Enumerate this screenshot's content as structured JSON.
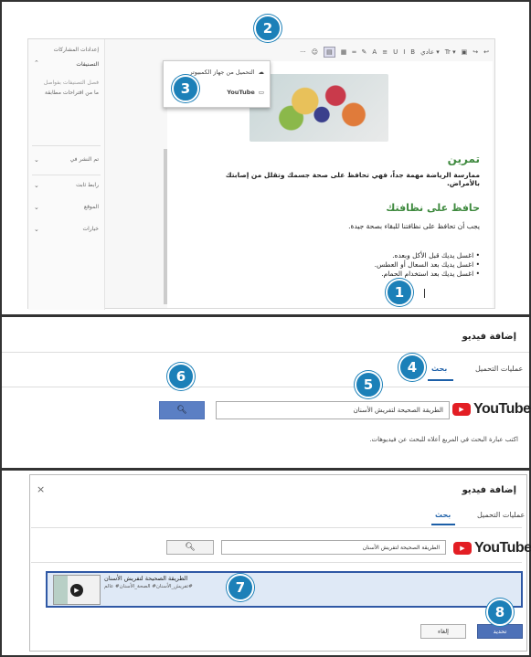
{
  "editor": {
    "toolbar_items": [
      "↩",
      "↪",
      "▣",
      "Tr ▾",
      "عادي ▾",
      "B",
      "I",
      "U",
      "≡",
      "A",
      "✎",
      "═",
      "▦",
      "▤",
      "☺",
      "···"
    ],
    "side_panel": {
      "header": "إعدادات المشاركات",
      "section_label": "التصنيفات",
      "search_hint": "فصل التصنيفات بفواصل",
      "suggestion": "ما من اقتراحات مطابقة",
      "items": [
        "تم النشر في",
        "رابط ثابت",
        "الموقع",
        "خيارات"
      ]
    },
    "dropdown": {
      "upload_label": "التحميل من جهاز الكمبيوتر",
      "youtube_label": "YouTube"
    },
    "doc": {
      "heading": "تمرين",
      "paragraph": "ممارسة الرياضة مهمة جداً، فهي تحافظ على صحة جسمك وتقلل من إصابتك بالأمراض.",
      "subheading": "حافظ على نظافتك",
      "intro": "يجب أن تحافظ على نظافتنا للبقاء بصحة جيدة.",
      "bullets": [
        "اغسل يديك قبل الأكل وبعده.",
        "اغسل يديك بعد السعال أو العطس.",
        "اغسل يديك بعد استخدام الحمام."
      ]
    }
  },
  "add_video": {
    "title": "إضافة فيديو",
    "tab_search": "بحث",
    "tab_uploads": "عمليات التحميل",
    "youtube_word": "YouTube",
    "search_value": "الطريقة الصحيحة لتفريش الأسنان",
    "hint": "اكتب عبارة البحث في المربع أعلاه للبحث عن فيديوهات."
  },
  "results_dialog": {
    "title": "إضافة فيديو",
    "tab_search": "بحث",
    "tab_uploads": "عمليات التحميل",
    "youtube_word": "YouTube",
    "search_value": "الطريقة الصحيحة لتفريش الأسنان",
    "result_title": "الطريقة الصحيحة لتفريش الأسنان",
    "result_tags": "تفريش_الأسنان# الصحة_الأسنان# عالم#",
    "select_label": "تحديد",
    "cancel_label": "إلغاء",
    "close": "×"
  },
  "callouts": [
    "1",
    "2",
    "3",
    "4",
    "5",
    "6",
    "7",
    "8"
  ],
  "colors": {
    "callout": "#1c80b8",
    "accent_blue": "#4d71b8",
    "green_heading": "#3f8a3f",
    "youtube_red": "#e31e24"
  }
}
